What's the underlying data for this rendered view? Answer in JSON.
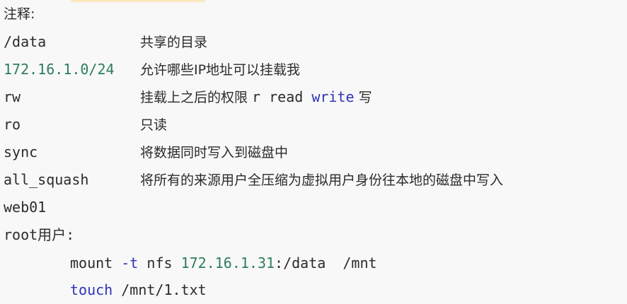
{
  "heading": "注释:",
  "rows": [
    {
      "key": "/data",
      "desc": "共享的目录"
    },
    {
      "key": "172.16.1.0/24",
      "desc": "允许哪些IP地址可以挂载我"
    },
    {
      "key": "rw",
      "desc_pre": "挂载上之后的权限 ",
      "desc_code1": "r read ",
      "desc_code_kw": "write",
      "desc_post": " 写"
    },
    {
      "key": "ro",
      "desc": "只读"
    },
    {
      "key": "sync",
      "desc": "将数据同时写入到磁盘中"
    },
    {
      "key": "all_squash",
      "desc": "将所有的来源用户全压缩为虚拟用户身份往本地的磁盘中写入"
    }
  ],
  "web_label": "web01",
  "root_label": "root用户:",
  "commands": [
    {
      "cmd": "mount",
      "flag": "-t",
      "type": "nfs",
      "ip": "172.16.1.31",
      "path": ":/data  /mnt"
    },
    {
      "cmd": "touch",
      "arg": " /mnt/1.txt"
    }
  ],
  "colors": {
    "text": "#2b2b2b",
    "number": "#2e7d5b",
    "keyword": "#2f33b8",
    "background": "#f8f8f8"
  }
}
